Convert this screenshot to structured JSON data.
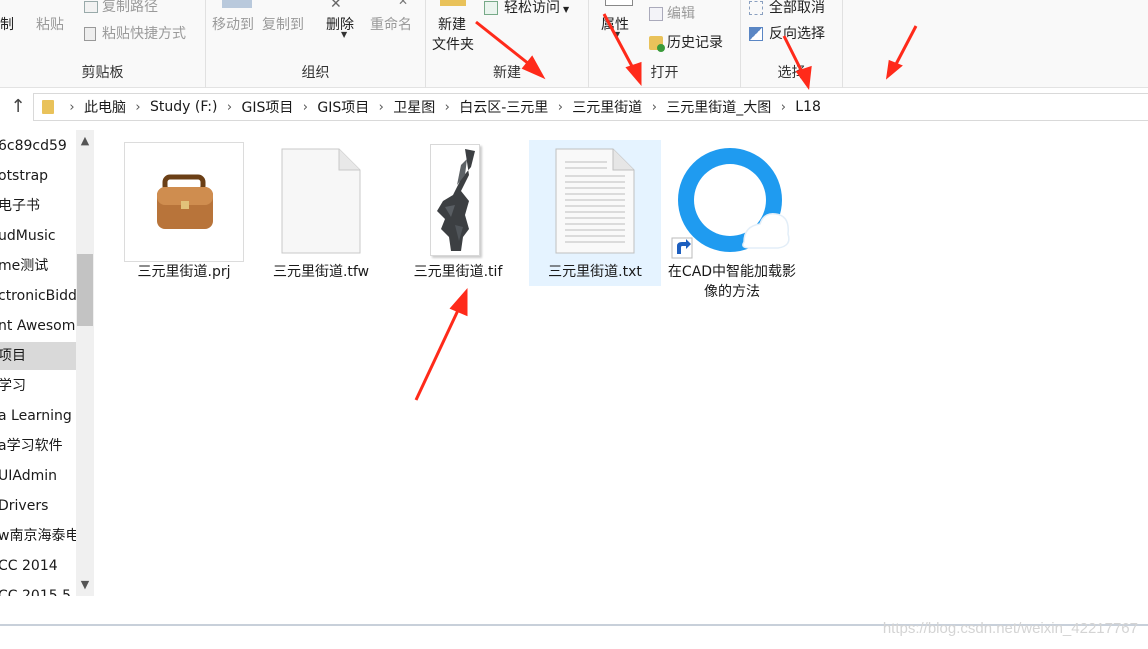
{
  "ribbon": {
    "clipboard": {
      "title": "剪贴板",
      "copy_label": "制",
      "paste_label": "粘贴",
      "copy_path_label": "复制路径",
      "paste_shortcut_label": "粘贴快捷方式"
    },
    "organize": {
      "title": "组织",
      "move_to_label": "移动到",
      "copy_to_label": "复制到",
      "delete_label": "删除",
      "rename_label": "重命名"
    },
    "new": {
      "title": "新建",
      "new_folder_line1": "新建",
      "new_folder_line2": "文件夹",
      "easy_access_label": "轻松访问"
    },
    "open": {
      "title": "打开",
      "properties_label": "属性",
      "edit_label": "编辑",
      "history_label": "历史记录"
    },
    "select": {
      "title": "选择",
      "select_none_label": "全部取消",
      "invert_label": "反向选择"
    }
  },
  "address": {
    "crumbs": [
      "此电脑",
      "Study (F:)",
      "GIS项目",
      "GIS项目",
      "卫星图",
      "白云区-三元里",
      "三元里街道",
      "三元里街道_大图",
      "L18"
    ]
  },
  "sidebar": {
    "items": [
      {
        "label": "6c89cd59"
      },
      {
        "label": "otstrap"
      },
      {
        "label": "电子书"
      },
      {
        "label": "udMusic"
      },
      {
        "label": "me测试"
      },
      {
        "label": "ctronicBidd"
      },
      {
        "label": "nt Awesom"
      },
      {
        "label": "项目"
      },
      {
        "label": "学习"
      },
      {
        "label": "a Learning"
      },
      {
        "label": "a学习软件"
      },
      {
        "label": "UIAdmin"
      },
      {
        "label": "Drivers"
      },
      {
        "label": "w南京海泰电"
      },
      {
        "label": "CC 2014"
      },
      {
        "label": "CC 2015.5"
      }
    ],
    "selected_index": 7
  },
  "files": [
    {
      "name": "三元里街道.prj",
      "icon": "briefcase-icon"
    },
    {
      "name": "三元里街道.tfw",
      "icon": "blank-document-icon"
    },
    {
      "name": "三元里街道.tif",
      "icon": "satellite-image-thumbnail"
    },
    {
      "name": "三元里街道.txt",
      "icon": "text-document-icon"
    },
    {
      "name": "在CAD中智能加载影像的方法",
      "icon": "browser-shortcut-icon"
    }
  ],
  "watermark": "https://blog.csdn.net/weixin_42217767",
  "colors": {
    "ribbon_bg": "#f9f9f9",
    "selected_file_bg": "#e5f3ff",
    "sidebar_selected_bg": "#d9d9d9",
    "annotation_red": "#ff2a1a"
  }
}
